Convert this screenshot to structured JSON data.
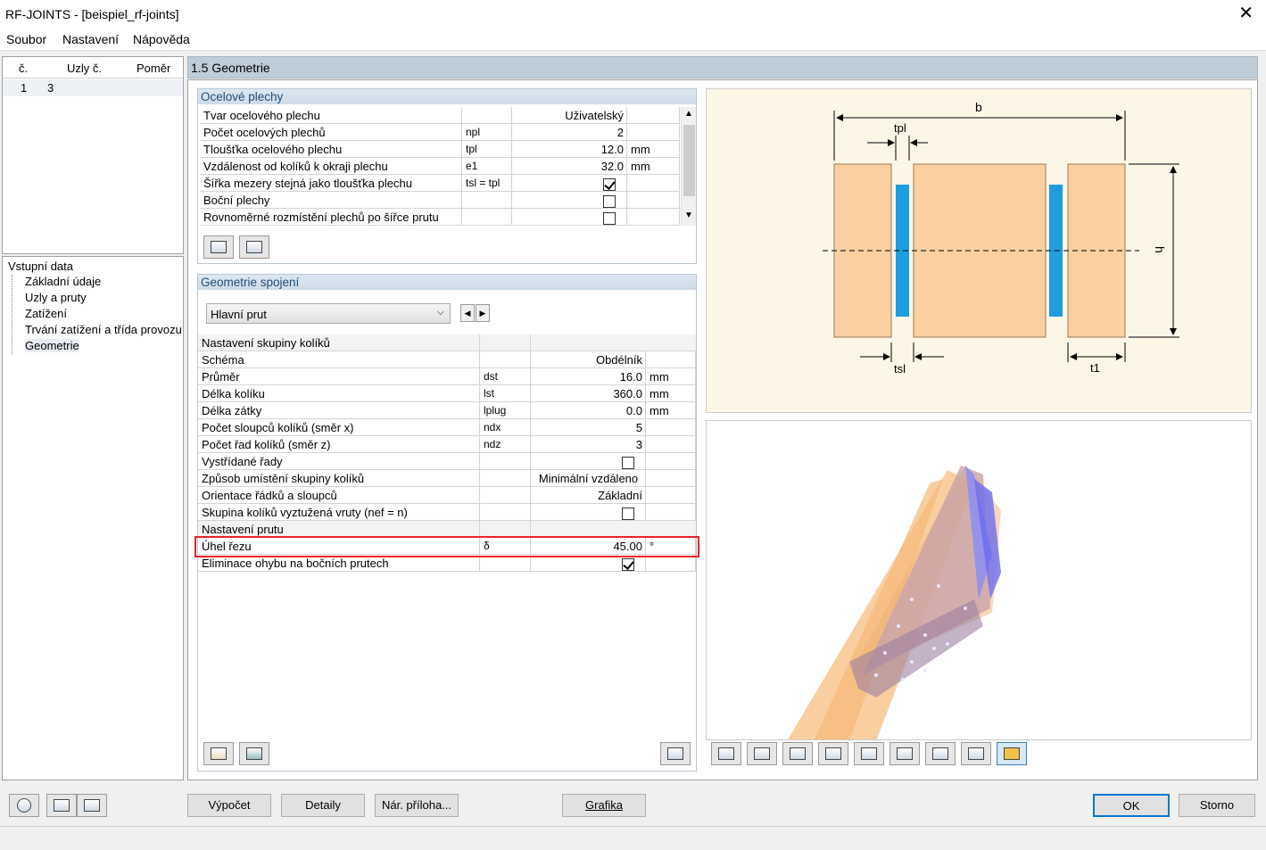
{
  "window": {
    "title": "RF-JOINTS - [beispiel_rf-joints]",
    "close": "✕"
  },
  "menu": [
    "Soubor",
    "Nastavení",
    "Nápověda"
  ],
  "nodes_table": {
    "headers": [
      "č.",
      "Uzly č.",
      "Poměr"
    ],
    "rows": [
      {
        "no": "1",
        "nodes": "3",
        "ratio": ""
      }
    ]
  },
  "tree": {
    "root": "Vstupní data",
    "items": [
      "Základní údaje",
      "Uzly a pruty",
      "Zatížení",
      "Trvání zatížení a třída provozu",
      "Geometrie"
    ],
    "selected": "Geometrie"
  },
  "page_title": "1.5 Geometrie",
  "steel_plates": {
    "title": "Ocelové plechy",
    "rows": [
      {
        "label": "Tvar ocelového plechu",
        "sym": "",
        "value": "Uživatelský",
        "unit": "",
        "type": "text"
      },
      {
        "label": "Počet ocelových plechů",
        "sym": "npl",
        "value": "2",
        "unit": "",
        "type": "num"
      },
      {
        "label": "Tloušťka ocelového plechu",
        "sym": "tpl",
        "value": "12.0",
        "unit": "mm",
        "type": "num"
      },
      {
        "label": "Vzdálenost od kolíků k okraji plechu",
        "sym": "e1",
        "value": "32.0",
        "unit": "mm",
        "type": "num"
      },
      {
        "label": "Šířka mezery stejná jako tloušťka plechu",
        "sym": "tsl = tpl",
        "value": true,
        "unit": "",
        "type": "check"
      },
      {
        "label": "Boční plechy",
        "sym": "",
        "value": false,
        "unit": "",
        "type": "check"
      },
      {
        "label": "Rovnoměrné rozmístění plechů po šířce prutu",
        "sym": "",
        "value": false,
        "unit": "",
        "type": "check"
      }
    ]
  },
  "joint_geometry": {
    "title": "Geometrie spojení",
    "member_select": "Hlavní prut",
    "rows": [
      {
        "label": "Nastavení skupiny kolíků",
        "sym": "",
        "value": "",
        "unit": "",
        "type": "group"
      },
      {
        "label": "Schéma",
        "sym": "",
        "value": "Obdélník",
        "unit": "",
        "type": "num"
      },
      {
        "label": "Průměr",
        "sym": "dst",
        "value": "16.0",
        "unit": "mm",
        "type": "num"
      },
      {
        "label": "Délka kolíku",
        "sym": "lst",
        "value": "360.0",
        "unit": "mm",
        "type": "num"
      },
      {
        "label": "Délka zátky",
        "sym": "lplug",
        "value": "0.0",
        "unit": "mm",
        "type": "num"
      },
      {
        "label": "Počet sloupců kolíků (směr x)",
        "sym": "ndx",
        "value": "5",
        "unit": "",
        "type": "num"
      },
      {
        "label": "Počet řad kolíků (směr z)",
        "sym": "ndz",
        "value": "3",
        "unit": "",
        "type": "num"
      },
      {
        "label": "Vystřídané řady",
        "sym": "",
        "value": false,
        "unit": "",
        "type": "check"
      },
      {
        "label": "Způsob umístění skupiny kolíků",
        "sym": "",
        "value": "Minimální vzdáleno",
        "unit": "",
        "type": "text"
      },
      {
        "label": "Orientace řádků a sloupců",
        "sym": "",
        "value": "Základní",
        "unit": "",
        "type": "num"
      },
      {
        "label": "Skupina kolíků vyztužená vruty (nef = n)",
        "sym": "",
        "value": false,
        "unit": "",
        "type": "check"
      },
      {
        "label": "Nastavení prutu",
        "sym": "",
        "value": "",
        "unit": "",
        "type": "group"
      },
      {
        "label": "Úhel řezu",
        "sym": "δ",
        "value": "45.00",
        "unit": "°",
        "type": "num",
        "highlight": true
      },
      {
        "label": "Eliminace ohybu na bočních prutech",
        "sym": "",
        "value": true,
        "unit": "",
        "type": "check"
      }
    ]
  },
  "diagram_labels": {
    "b": "b",
    "tpl": "tpl",
    "h": "h",
    "tsl": "tsl",
    "t1": "t1"
  },
  "buttons": {
    "calc": "Výpočet",
    "details": "Detaily",
    "annex": "Nár. příloha...",
    "graphics": "Grafika",
    "ok": "OK",
    "cancel": "Storno"
  },
  "icons": [
    "help-icon",
    "import-icon",
    "export-icon"
  ]
}
